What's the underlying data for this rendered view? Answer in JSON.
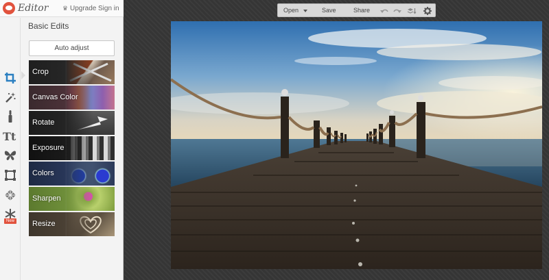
{
  "app": {
    "brand": "Editor",
    "upgrade_label": "Upgrade",
    "signin_label": "Sign in"
  },
  "toolstrip": {
    "tools": [
      {
        "name": "crop-icon",
        "active": true
      },
      {
        "name": "magic-wand-icon"
      },
      {
        "name": "brush-icon"
      },
      {
        "name": "text-icon"
      },
      {
        "name": "butterfly-icon"
      },
      {
        "name": "frame-icon"
      },
      {
        "name": "texture-icon"
      },
      {
        "name": "snowflake-icon"
      }
    ],
    "new_badge": "New",
    "accent_color": "#e1523d"
  },
  "panel": {
    "title": "Basic Edits",
    "auto_adjust_label": "Auto adjust",
    "items": [
      {
        "label": "Crop"
      },
      {
        "label": "Canvas Color"
      },
      {
        "label": "Rotate"
      },
      {
        "label": "Exposure"
      },
      {
        "label": "Colors"
      },
      {
        "label": "Sharpen"
      },
      {
        "label": "Resize"
      }
    ]
  },
  "toolbar": {
    "open_label": "Open",
    "save_label": "Save",
    "share_label": "Share"
  }
}
